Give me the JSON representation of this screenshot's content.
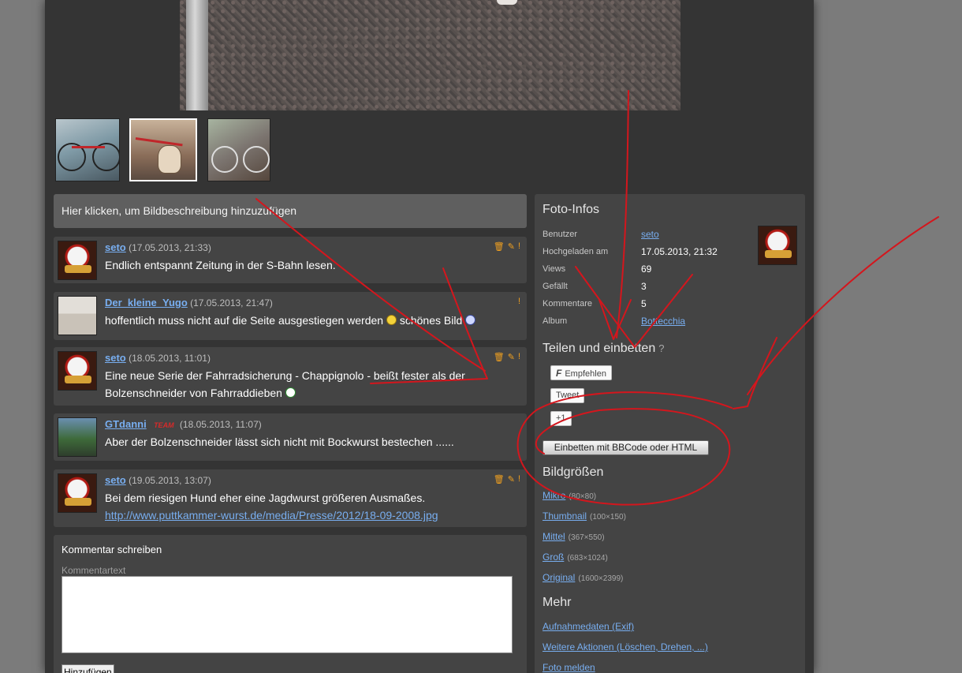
{
  "photo": {
    "thumbnails": [
      "thumbnail-1",
      "thumbnail-2",
      "thumbnail-3"
    ]
  },
  "description_prompt": "Hier klicken, um Bildbeschreibung hinzuzufügen",
  "comments": [
    {
      "user": "seto",
      "date": "(17.05.2013, 21:33)",
      "text": "Endlich entspannt Zeitung in der S-Bahn lesen."
    },
    {
      "user": "Der_kleine_Yugo",
      "date": "(17.05.2013, 21:47)",
      "text_a": "hoffentlich muss nicht auf die Seite ausgestiegen werden",
      "text_b": "schönes Bild"
    },
    {
      "user": "seto",
      "date": "(18.05.2013, 11:01)",
      "text": "Eine neue Serie der Fahrradsicherung - Chappignolo - beißt fester als der Bolzenschneider von Fahrraddieben"
    },
    {
      "user": "GTdanni",
      "badge": "TEAM",
      "date": "(18.05.2013, 11:07)",
      "text": "Aber der Bolzenschneider lässt sich nicht mit Bockwurst bestechen ......"
    },
    {
      "user": "seto",
      "date": "(19.05.2013, 13:07)",
      "text": "Bei dem riesigen Hund eher eine Jagdwurst größeren Ausmaßes.",
      "link": "http://www.puttkammer-wurst.de/media/Presse/2012/18-09-2008.jpg"
    }
  ],
  "tools": {
    "delete": "🗑",
    "edit": "✎",
    "report": "!"
  },
  "write": {
    "title": "Kommentar schreiben",
    "label": "Kommentartext",
    "button": "Hinzufügen"
  },
  "info": {
    "title": "Foto-Infos",
    "rows": [
      {
        "label": "Benutzer",
        "value": "seto"
      },
      {
        "label": "Hochgeladen am",
        "value": "17.05.2013, 21:32"
      },
      {
        "label": "Views",
        "value": "69"
      },
      {
        "label": "Gefällt",
        "value": "3"
      },
      {
        "label": "Kommentare",
        "value": "5"
      },
      {
        "label": "Album",
        "value": "Bottecchia"
      }
    ],
    "share_title": "Teilen und einbetten",
    "share_help": "?",
    "facebook": "Empfehlen",
    "facebook_icon": "F",
    "tweet": "Tweet",
    "plusone": "+1",
    "embed": "Einbetten mit BBCode oder HTML",
    "sizes_title": "Bildgrößen",
    "sizes": [
      {
        "name": "Mikro",
        "dim": "(80×80)"
      },
      {
        "name": "Thumbnail",
        "dim": "(100×150)"
      },
      {
        "name": "Mittel",
        "dim": "(367×550)"
      },
      {
        "name": "Groß",
        "dim": "(683×1024)"
      },
      {
        "name": "Original",
        "dim": "(1600×2399)"
      }
    ],
    "more_title": "Mehr",
    "more": [
      "Aufnahmedaten (Exif)",
      "Weitere Aktionen (Löschen, Drehen, ...)",
      "Foto melden"
    ]
  },
  "colors": {
    "link": "#78aef0",
    "annotation": "#d4161d",
    "tool": "#f0a020",
    "badge": "#d62a2a"
  }
}
